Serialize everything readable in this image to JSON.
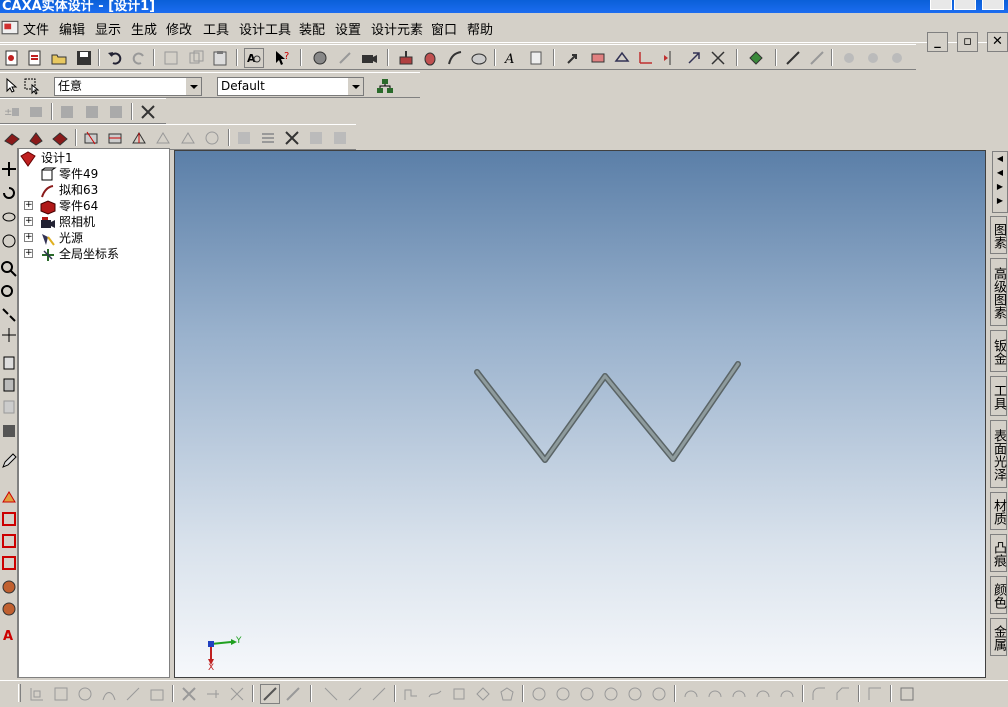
{
  "window": {
    "title": "CAXA实体设计 - [设计1]"
  },
  "menu": [
    "文件",
    "编辑",
    "显示",
    "生成",
    "修改",
    "工具",
    "设计工具",
    "装配",
    "设置",
    "设计元素",
    "窗口",
    "帮助"
  ],
  "filters": {
    "selection_filter": "任意",
    "style_filter": "Default"
  },
  "tree": {
    "root": "设计1",
    "items": [
      "零件49",
      "拟和63",
      "零件64",
      "照相机",
      "光源",
      "全局坐标系"
    ]
  },
  "right_tabs": [
    "图素",
    "高级图素",
    "钣金",
    "工具",
    "表面光泽",
    "材质",
    "凸痕",
    "颜色",
    "金属"
  ],
  "axes": {
    "x": "X",
    "y": "Y"
  },
  "colors": {
    "titlebar": "#0a5fd8",
    "menu_bg": "#d4d0c8",
    "viewport_top": "#5b7fa8",
    "viewport_bottom": "#f6f8fb",
    "model": "#7d8a8c"
  }
}
